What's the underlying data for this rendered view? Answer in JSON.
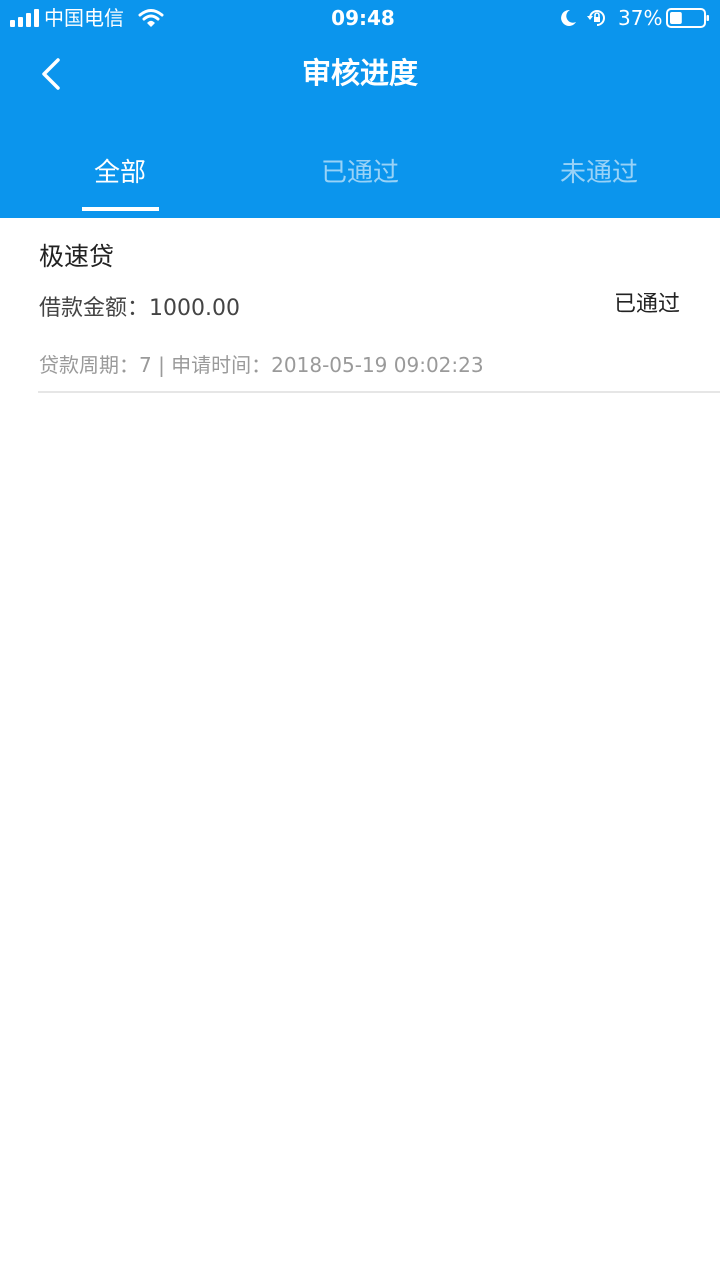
{
  "status_bar": {
    "carrier": "中国电信",
    "time": "09:48",
    "battery_percent": "37%",
    "battery_level": 0.37,
    "icons": [
      "signal-icon",
      "wifi-icon",
      "moon-icon",
      "rotation-lock-icon",
      "battery-icon"
    ]
  },
  "nav": {
    "title": "审核进度",
    "back_icon": "chevron-left-icon"
  },
  "tabs": [
    {
      "label": "全部",
      "active": true
    },
    {
      "label": "已通过",
      "active": false
    },
    {
      "label": "未通过",
      "active": false
    }
  ],
  "records": [
    {
      "product": "极速贷",
      "amount_label": "借款金额：",
      "amount": "1000.00",
      "status": "已通过",
      "meta": "贷款周期：7 | 申请时间：2018-05-19 09:02:23"
    }
  ],
  "colors": {
    "header_bg": "#0b95ed",
    "tab_active": "#ffffff",
    "tab_inactive": "rgba(255,255,255,0.58)",
    "meta_text": "#9a9a9a"
  }
}
